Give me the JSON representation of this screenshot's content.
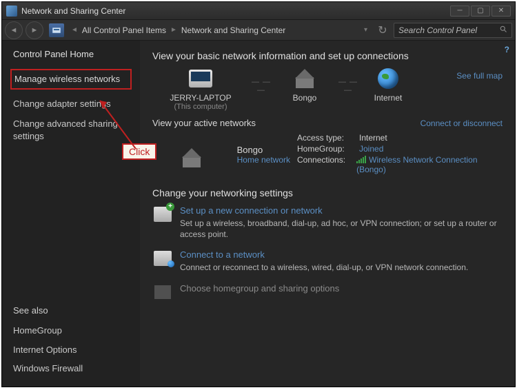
{
  "window": {
    "title": "Network and Sharing Center"
  },
  "breadcrumb": {
    "item1": "All Control Panel Items",
    "item2": "Network and Sharing Center"
  },
  "search": {
    "placeholder": "Search Control Panel"
  },
  "sidebar": {
    "home": "Control Panel Home",
    "links": {
      "manage_wireless": "Manage wireless networks",
      "adapter": "Change adapter settings",
      "advanced": "Change advanced sharing settings"
    },
    "seealso": "See also",
    "bottom": {
      "homegroup": "HomeGroup",
      "ie": "Internet Options",
      "firewall": "Windows Firewall"
    }
  },
  "annotation": {
    "click": "Click"
  },
  "main": {
    "heading": "View your basic network information and set up connections",
    "map_link": "See full map",
    "nodes": {
      "computer": "JERRY-LAPTOP",
      "computer_sub": "(This computer)",
      "router": "Bongo",
      "internet": "Internet"
    },
    "active_heading": "View your active networks",
    "disconnect": "Connect or disconnect",
    "active_network": {
      "name": "Bongo",
      "type": "Home network",
      "access_label": "Access type:",
      "access_value": "Internet",
      "homegroup_label": "HomeGroup:",
      "homegroup_value": "Joined",
      "conn_label": "Connections:",
      "conn_value": "Wireless Network Connection (Bongo)"
    },
    "settings_heading": "Change your networking settings",
    "settings": {
      "setup_title": "Set up a new connection or network",
      "setup_desc": "Set up a wireless, broadband, dial-up, ad hoc, or VPN connection; or set up a router or access point.",
      "connect_title": "Connect to a network",
      "connect_desc": "Connect or reconnect to a wireless, wired, dial-up, or VPN network connection.",
      "homegroup_title": "Choose homegroup and sharing options"
    }
  }
}
